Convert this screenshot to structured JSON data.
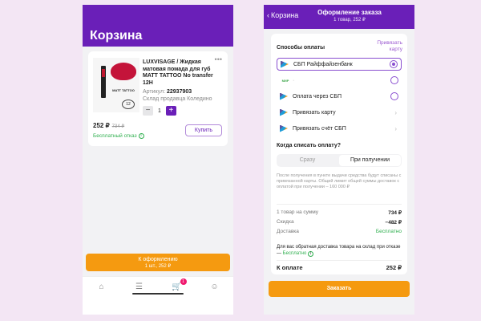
{
  "left": {
    "title": "Корзина",
    "product": {
      "name": "LUXVISAGE / Жидкая матовая помада для губ MATT TATTOO No transfer 12H",
      "article_label": "Артикул:",
      "article": "22937903",
      "stock": "Склад продавца Коледино",
      "qty": "1",
      "price": "252 ₽",
      "old_price": "734 ₽",
      "free_return": "Бесплатный отказ",
      "buy_label": "Купить",
      "thumb_brand": "MATT TATTOO",
      "thumb_badge": "12"
    },
    "checkout": {
      "label": "К оформлению",
      "sub": "1 шт., 252 ₽"
    },
    "cart_count": "1"
  },
  "right": {
    "back": "Корзина",
    "title": "Оформление заказа",
    "subtitle": "1 товар, 252 ₽",
    "payment": {
      "title": "Способы оплаты",
      "link": "Привязать карту",
      "methods": [
        {
          "label": "СБП Райффайзенбанк",
          "logo": "sbp-logo",
          "control": "radio-on"
        },
        {
          "label": "·",
          "logo": "mir-logo",
          "control": "radio"
        },
        {
          "label": "Оплата через СБП",
          "logo": "sbp-logo",
          "control": "radio"
        },
        {
          "label": "Привязать карту",
          "logo": "sbp-logo",
          "control": "chevron"
        },
        {
          "label": "Привязать счёт СБП",
          "logo": "sbp-logo",
          "control": "chevron"
        }
      ],
      "mir_text": "МИР"
    },
    "when": {
      "title": "Когда списать оплату?",
      "opt1": "Сразу",
      "opt2": "При получении"
    },
    "note": "После получения в пункте выдачи средства будут списаны с привязанной карты. Общий лимит общей суммы доставок с оплатой при получении – 160 000 ₽",
    "summary": [
      {
        "label": "1 товар на сумму",
        "value": "734 ₽"
      },
      {
        "label": "Скидка",
        "value": "−482 ₽"
      },
      {
        "label": "Доставка",
        "value": "Бесплатно"
      }
    ],
    "return_note": "Для вас обратная доставка товара на склад при отказе —",
    "return_free": "Бесплатно",
    "total_label": "К оплате",
    "total_value": "252 ₽",
    "order_label": "Заказать"
  },
  "colors": {
    "brand": "#6a1fb8",
    "accent": "#f59a10",
    "success": "#2cae4c",
    "badge": "#f0186e"
  },
  "icons": [
    "home-icon",
    "catalog-icon",
    "cart-icon",
    "profile-icon",
    "back-chevron-icon",
    "info-icon"
  ]
}
